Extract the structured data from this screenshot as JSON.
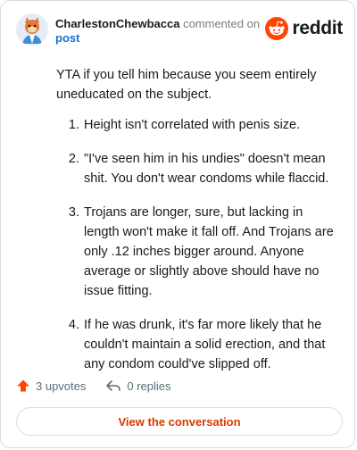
{
  "header": {
    "username": "CharlestonChewbacca",
    "action": "commented on",
    "post_link": "post",
    "brand": "reddit"
  },
  "comment": {
    "intro": "YTA if you tell him because you seem entirely uneducated on the subject.",
    "points": [
      "Height isn't correlated with penis size.",
      "\"I've seen him in his undies\" doesn't mean shit. You don't wear condoms while flaccid.",
      "Trojans are longer, sure, but lacking in length won't make it fall off. And Trojans are only .12 inches bigger around. Anyone average or slightly above should have no issue fitting.",
      "If he was drunk, it's far more likely that he couldn't maintain a solid erection, and that any condom could've slipped off."
    ]
  },
  "footer": {
    "upvotes": "3 upvotes",
    "replies": "0 replies",
    "cta": "View the conversation"
  },
  "colors": {
    "accent": "#d93a00",
    "upvote": "#ff4500",
    "link": "#1c6fd1"
  }
}
